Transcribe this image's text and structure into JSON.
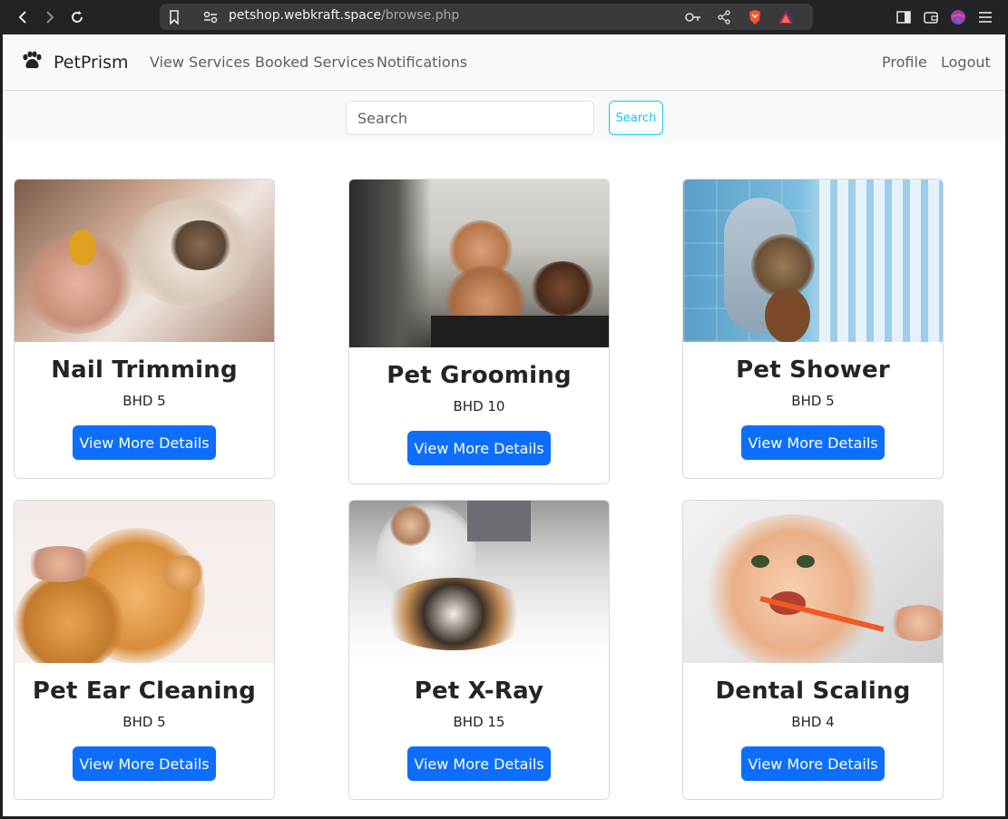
{
  "browser": {
    "url_host": "petshop.webkraft.space",
    "url_path": "/browse.php"
  },
  "navbar": {
    "brand": "PetPrism",
    "links": [
      "View Services",
      "Booked Services",
      "Notifications"
    ],
    "right_links": [
      "Profile",
      "Logout"
    ]
  },
  "search": {
    "placeholder": "Search",
    "button_label": "Search"
  },
  "services": [
    {
      "title": "Nail Trimming",
      "price": "BHD 5",
      "button": "View More Details",
      "icon": "cat-nail-trim-photo"
    },
    {
      "title": "Pet Grooming",
      "price": "BHD 10",
      "button": "View More Details",
      "icon": "poodle-grooming-photo"
    },
    {
      "title": "Pet Shower",
      "price": "BHD 5",
      "button": "View More Details",
      "icon": "cat-towel-shower-photo"
    },
    {
      "title": "Pet Ear Cleaning",
      "price": "BHD 5",
      "button": "View More Details",
      "icon": "dog-ear-cleaning-photo"
    },
    {
      "title": "Pet X-Ray",
      "price": "BHD 15",
      "button": "View More Details",
      "icon": "cat-xray-vet-photo"
    },
    {
      "title": "Dental Scaling",
      "price": "BHD 4",
      "button": "View More Details",
      "icon": "cat-toothbrush-photo"
    }
  ],
  "colors": {
    "primary": "#0d6efd",
    "info": "#0dcaf0",
    "navbar_bg": "#f8f9fa"
  }
}
